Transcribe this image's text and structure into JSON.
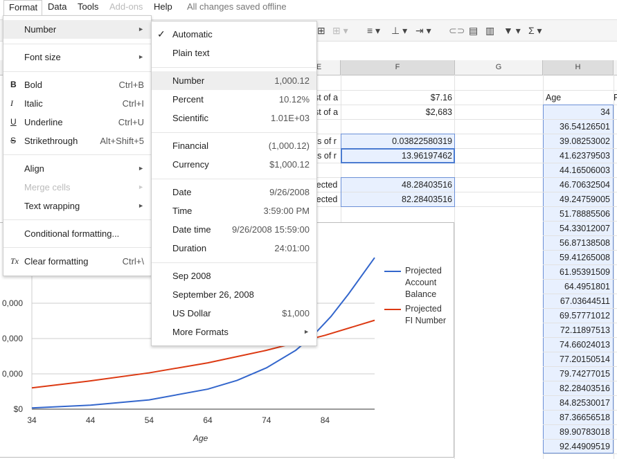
{
  "menubar": {
    "items": [
      {
        "label": "Format"
      },
      {
        "label": "Data"
      },
      {
        "label": "Tools"
      },
      {
        "label": "Add-ons"
      },
      {
        "label": "Help"
      }
    ],
    "status": "All changes saved offline"
  },
  "toolbar": {
    "icons": [
      "align-icon",
      "valign-icon",
      "text-direction-icon",
      "link-icon",
      "comment-icon",
      "chart-icon",
      "filter-icon",
      "functions-icon"
    ]
  },
  "columns": {
    "E": "E",
    "F": "F",
    "G": "G",
    "H": "H"
  },
  "cells": {
    "e_row1": "st of a",
    "e_row2": "st of a",
    "e_row4": "rs of r",
    "e_row5": "rs of r",
    "e_row7": "jected",
    "e_row8": "jected",
    "f_row1": "$7.16",
    "f_row2": "$2,683",
    "f_row4": "0.03822580319",
    "f_row5": "13.96197462",
    "f_row7": "48.28403516",
    "f_row8": "82.28403516",
    "h_header": "Age",
    "h_values": [
      "34",
      "36.54126501",
      "39.08253002",
      "41.62379503",
      "44.16506003",
      "46.70632504",
      "49.24759005",
      "51.78885506",
      "54.33012007",
      "56.87138508",
      "59.41265008",
      "61.95391509",
      "64.4951801",
      "67.03644511",
      "69.57771012",
      "72.11897513",
      "74.66024013",
      "77.20150514",
      "79.74277015",
      "82.28403516",
      "84.82530017",
      "87.36656518",
      "89.90783018",
      "92.44909519"
    ]
  },
  "format_menu": {
    "items": [
      {
        "label": "Number",
        "arrow": "►"
      },
      {
        "label": "Font size",
        "arrow": "►"
      },
      {
        "label": "Bold",
        "shortcut": "Ctrl+B",
        "icon": "B"
      },
      {
        "label": "Italic",
        "shortcut": "Ctrl+I",
        "icon": "I"
      },
      {
        "label": "Underline",
        "shortcut": "Ctrl+U",
        "icon": "U"
      },
      {
        "label": "Strikethrough",
        "shortcut": "Alt+Shift+5",
        "icon": "S"
      },
      {
        "label": "Align",
        "arrow": "►"
      },
      {
        "label": "Merge cells",
        "arrow": "►"
      },
      {
        "label": "Text wrapping",
        "arrow": "►"
      },
      {
        "label": "Conditional formatting..."
      },
      {
        "label": "Clear formatting",
        "shortcut": "Ctrl+\\",
        "icon": "Tx"
      }
    ]
  },
  "number_submenu": {
    "items": [
      {
        "label": "Automatic",
        "check": "✓"
      },
      {
        "label": "Plain text"
      },
      {
        "label": "Number",
        "example": "1,000.12"
      },
      {
        "label": "Percent",
        "example": "10.12%"
      },
      {
        "label": "Scientific",
        "example": "1.01E+03"
      },
      {
        "label": "Financial",
        "example": "(1,000.12)"
      },
      {
        "label": "Currency",
        "example": "$1,000.12"
      },
      {
        "label": "Date",
        "example": "9/26/2008"
      },
      {
        "label": "Time",
        "example": "3:59:00 PM"
      },
      {
        "label": "Date time",
        "example": "9/26/2008 15:59:00"
      },
      {
        "label": "Duration",
        "example": "24:01:00"
      },
      {
        "label": "Sep 2008"
      },
      {
        "label": "September 26, 2008"
      },
      {
        "label": "US Dollar",
        "example": "$1,000"
      },
      {
        "label": "More Formats",
        "arrow": "►"
      }
    ]
  },
  "chart_data": {
    "type": "line",
    "title": "",
    "xlabel": "Age",
    "ylabel": "",
    "xlim": [
      34,
      92.45
    ],
    "xticks": [
      "34",
      "44",
      "54",
      "64",
      "74",
      "84"
    ],
    "yticks": [
      "$0",
      "0,000",
      "0,000",
      "0,000"
    ],
    "series": [
      {
        "name": "Projected Account Balance",
        "color": "#3366cc",
        "x": [
          34,
          44,
          54,
          64,
          69,
          74,
          79,
          82,
          85,
          88,
          92.45
        ],
        "y": [
          0.5,
          1.6,
          3.7,
          8.0,
          11.5,
          16.5,
          23.5,
          29.5,
          37.0,
          46.0,
          60.5
        ]
      },
      {
        "name": "Projected FI Number",
        "color": "#dc3912",
        "x": [
          34,
          44,
          54,
          64,
          74,
          84,
          92.45
        ],
        "y": [
          8.5,
          11.3,
          14.5,
          18.5,
          23.5,
          29.5,
          35.5
        ]
      }
    ],
    "legend": "right"
  }
}
